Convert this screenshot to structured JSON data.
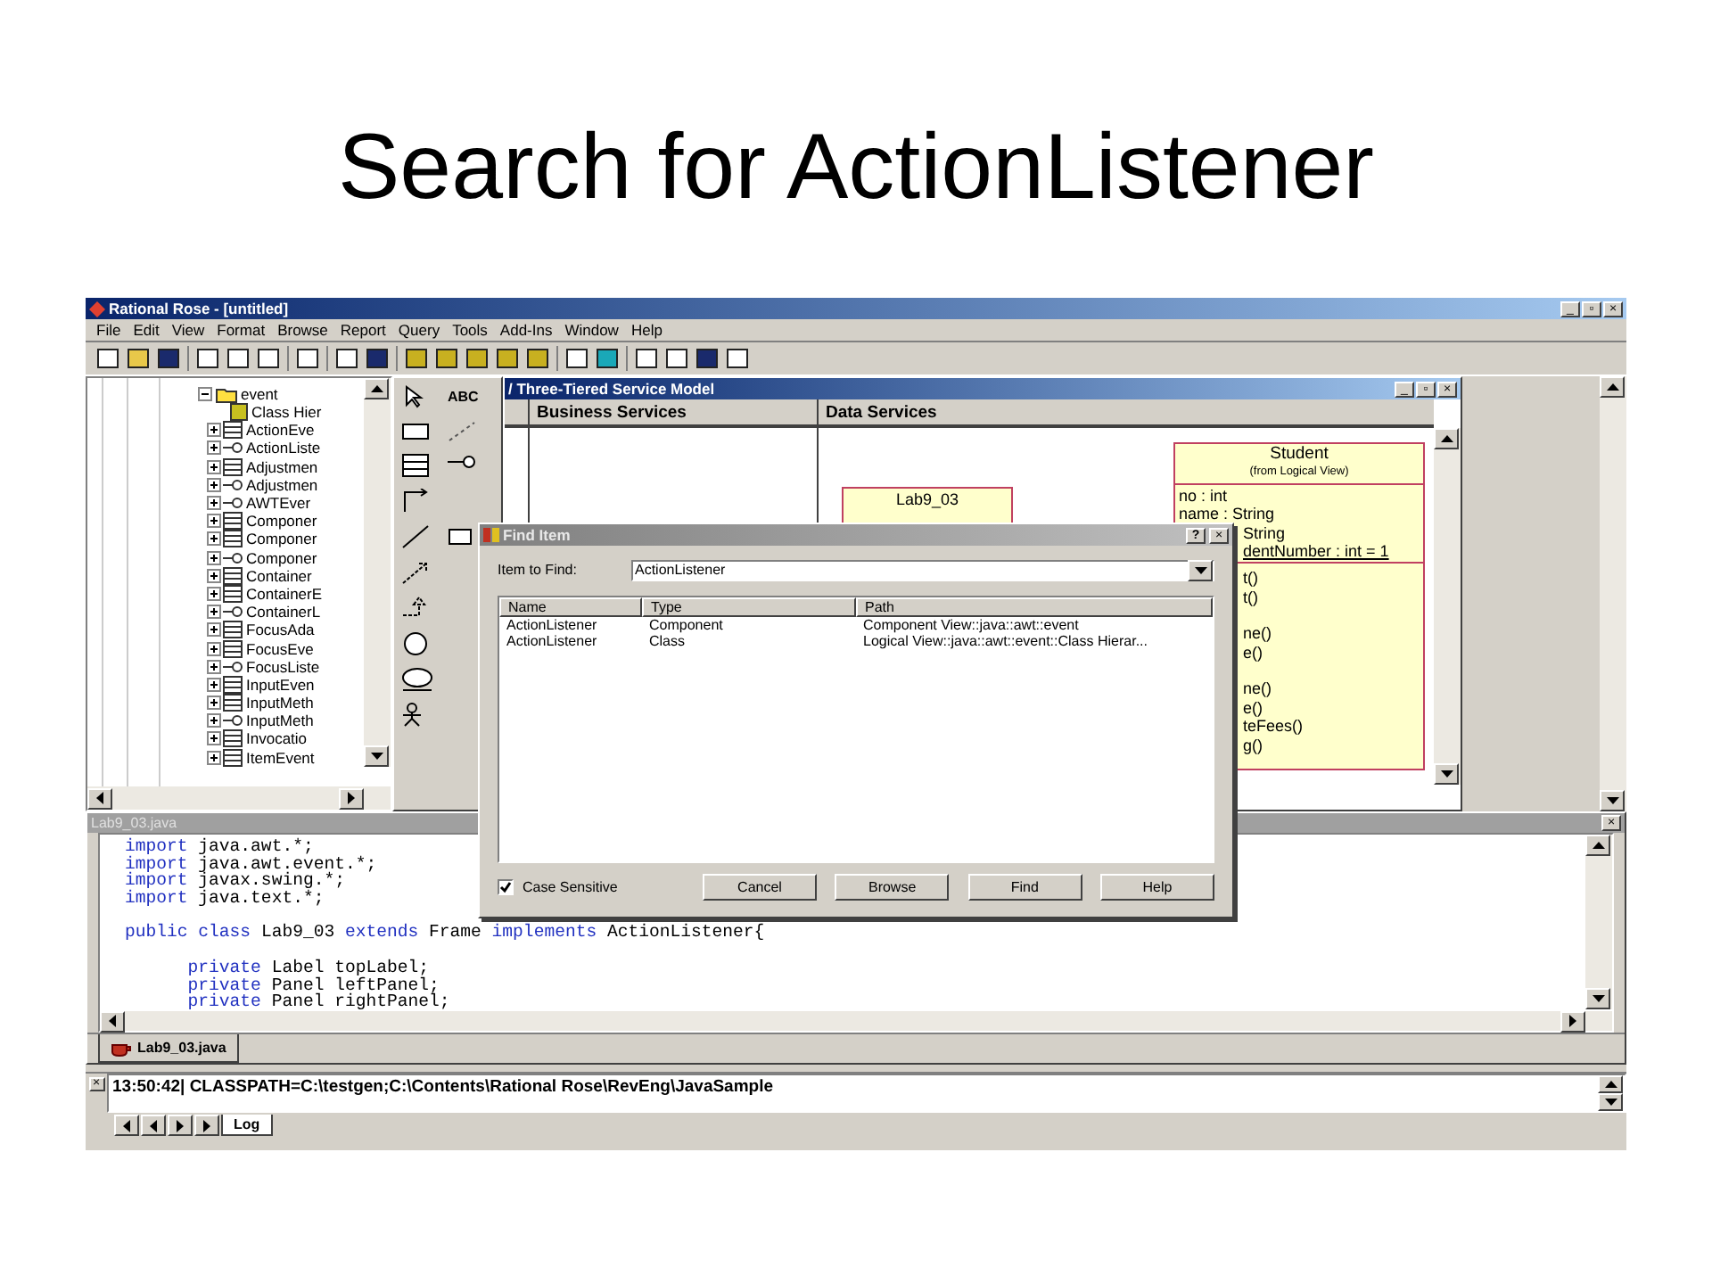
{
  "slide_title": "Search for ActionListener",
  "app": {
    "title": "Rational Rose - [untitled]",
    "window_buttons": [
      "_",
      "▫",
      "×"
    ],
    "menu": [
      "File",
      "Edit",
      "View",
      "Format",
      "Browse",
      "Report",
      "Query",
      "Tools",
      "Add-Ins",
      "Window",
      "Help"
    ]
  },
  "tree": {
    "label": "event",
    "expanded": true,
    "children": [
      {
        "label": "Class Hier",
        "kind": "category"
      },
      {
        "label": "ActionEve",
        "kind": "class"
      },
      {
        "label": "ActionListe",
        "kind": "interface"
      },
      {
        "label": "Adjustmen",
        "kind": "class"
      },
      {
        "label": "Adjustmen",
        "kind": "interface"
      },
      {
        "label": "AWTEver",
        "kind": "interface"
      },
      {
        "label": "Componer",
        "kind": "class"
      },
      {
        "label": "Componer",
        "kind": "class"
      },
      {
        "label": "Componer",
        "kind": "interface"
      },
      {
        "label": "Container",
        "kind": "class"
      },
      {
        "label": "ContainerE",
        "kind": "class"
      },
      {
        "label": "ContainerL",
        "kind": "interface"
      },
      {
        "label": "FocusAda",
        "kind": "class"
      },
      {
        "label": "FocusEve",
        "kind": "class"
      },
      {
        "label": "FocusListe",
        "kind": "interface"
      },
      {
        "label": "InputEven",
        "kind": "class"
      },
      {
        "label": "InputMeth",
        "kind": "class"
      },
      {
        "label": "InputMeth",
        "kind": "interface"
      },
      {
        "label": "Invocatio",
        "kind": "class"
      },
      {
        "label": "ItemEvent",
        "kind": "class"
      }
    ]
  },
  "toolbox": {
    "text_tool": "ABC"
  },
  "diagram": {
    "title": "/ Three-Tiered Service Model",
    "swimlanes": [
      "Business Services",
      "Data Services"
    ],
    "lab_class": {
      "name": "Lab9_03"
    },
    "student_class": {
      "name": "Student",
      "origin": "(from Logical View)",
      "attributes": [
        {
          "text": "no : int",
          "static": false
        },
        {
          "text": "name : String",
          "static": false
        }
      ],
      "partial_attributes": [
        {
          "text": "String",
          "static": false
        },
        {
          "text": "dentNumber : int = 1",
          "static": true
        }
      ],
      "operation_groups": [
        [
          "t()",
          "t()"
        ],
        [
          "ne()",
          "e()"
        ],
        [
          "ne()",
          "e()",
          "teFees()",
          "g()"
        ]
      ]
    }
  },
  "dialog": {
    "title": "Find Item",
    "help_button": "?",
    "field_label": "Item to Find:",
    "field_value": "ActionListener",
    "columns": [
      "Name",
      "Type",
      "Path"
    ],
    "rows": [
      [
        "ActionListener",
        "Component",
        "Component View::java::awt::event"
      ],
      [
        "ActionListener",
        "Class",
        "Logical View::java::awt::event::Class Hierar..."
      ]
    ],
    "checkbox": {
      "label": "Case Sensitive",
      "checked": true
    },
    "buttons": [
      "Cancel",
      "Browse",
      "Find",
      "Help"
    ]
  },
  "editor": {
    "title": "Lab9_03.java",
    "blocks": [
      [
        [
          {
            "text": "import",
            "kind": "keyword"
          },
          {
            "text": " java.awt.*;",
            "kind": "plain"
          }
        ],
        [
          {
            "text": "import",
            "kind": "keyword"
          },
          {
            "text": " java.awt.event.*;",
            "kind": "plain"
          }
        ],
        [
          {
            "text": "import",
            "kind": "keyword"
          },
          {
            "text": " javax.swing.*;",
            "kind": "plain"
          }
        ],
        [
          {
            "text": "import",
            "kind": "keyword"
          },
          {
            "text": " java.text.*;",
            "kind": "plain"
          }
        ]
      ],
      [
        [
          {
            "text": "public class",
            "kind": "keyword"
          },
          {
            "text": " Lab9_03 ",
            "kind": "plain"
          },
          {
            "text": "extends",
            "kind": "keyword"
          },
          {
            "text": " Frame ",
            "kind": "plain"
          },
          {
            "text": "implements",
            "kind": "keyword"
          },
          {
            "text": " ActionListener{",
            "kind": "plain"
          }
        ]
      ],
      [
        [
          {
            "text": "      private",
            "kind": "keyword"
          },
          {
            "text": " Label topLabel;",
            "kind": "plain"
          }
        ],
        [
          {
            "text": "      private",
            "kind": "keyword"
          },
          {
            "text": " Panel leftPanel;",
            "kind": "plain"
          }
        ],
        [
          {
            "text": "      private",
            "kind": "keyword"
          },
          {
            "text": " Panel rightPanel;",
            "kind": "plain"
          }
        ]
      ]
    ],
    "tabs": [
      {
        "label": "Lab9_03.java",
        "selected": true
      }
    ]
  },
  "log": {
    "line": "13:50:42|  CLASSPATH=C:\\testgen;C:\\Contents\\Rational Rose\\RevEng\\JavaSample",
    "tabs": [
      {
        "label": "Log",
        "selected": true
      }
    ]
  }
}
